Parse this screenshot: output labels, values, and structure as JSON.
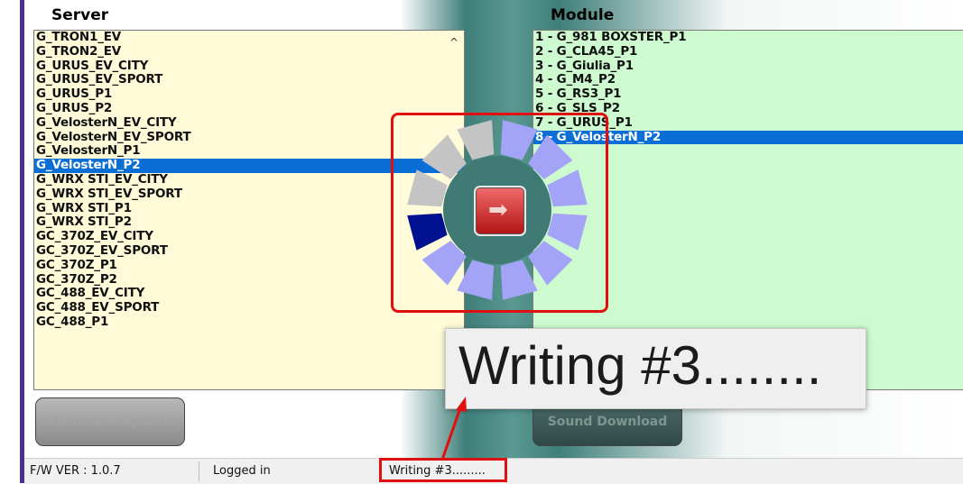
{
  "server": {
    "title": "Server",
    "items": [
      "G_TRON1_EV",
      "G_TRON2_EV",
      "G_URUS_EV_CITY",
      "G_URUS_EV_SPORT",
      "G_URUS_P1",
      "G_URUS_P2",
      "G_VelosterN_EV_CITY",
      "G_VelosterN_EV_SPORT",
      "G_VelosterN_P1",
      "G_VelosterN_P2",
      "G_WRX STI_EV_CITY",
      "G_WRX STI_EV_SPORT",
      "G_WRX STI_P1",
      "G_WRX STI_P2",
      "GC_370Z_EV_CITY",
      "GC_370Z_EV_SPORT",
      "GC_370Z_P1",
      "GC_370Z_P2",
      "GC_488_EV_CITY",
      "GC_488_EV_SPORT",
      "GC_488_P1"
    ],
    "selected_index": 9
  },
  "module": {
    "title": "Module",
    "items": [
      "1 - G_981 BOXSTER_P1",
      "2 - G_CLA45_P1",
      "3 - G_Giulia_P1",
      "4 - G_M4_P2",
      "5 - G_RS3_P1",
      "6 - G_SLS_P2",
      "7 - G_URUS_P1",
      "8 - G_VelosterN_P2"
    ],
    "selected_index": 7
  },
  "buttons": {
    "firmware_update": "Firmware Update",
    "sound_download": "Sound Download"
  },
  "status": {
    "fw_version": "F/W VER : 1.0.7",
    "login": "Logged in",
    "progress": "Writing #3........."
  },
  "zoom_callout": "Writing #3........",
  "scroll_up_glyph": "^",
  "transfer_glyph": "➡",
  "colors": {
    "server_bg": "#fffbd8",
    "module_bg": "#cdfbcf",
    "selection": "#0a6ed7",
    "spinner_active": "#a3a3f7",
    "spinner_inactive": "#c4c4c4",
    "spinner_current": "#00108f",
    "highlight": "#e01010"
  },
  "spinner": {
    "segments": 12,
    "current_segment": 8,
    "active_segments": [
      0,
      1,
      2,
      3,
      4,
      5,
      6,
      7
    ],
    "inactive_segments": [
      9,
      10,
      11
    ]
  }
}
